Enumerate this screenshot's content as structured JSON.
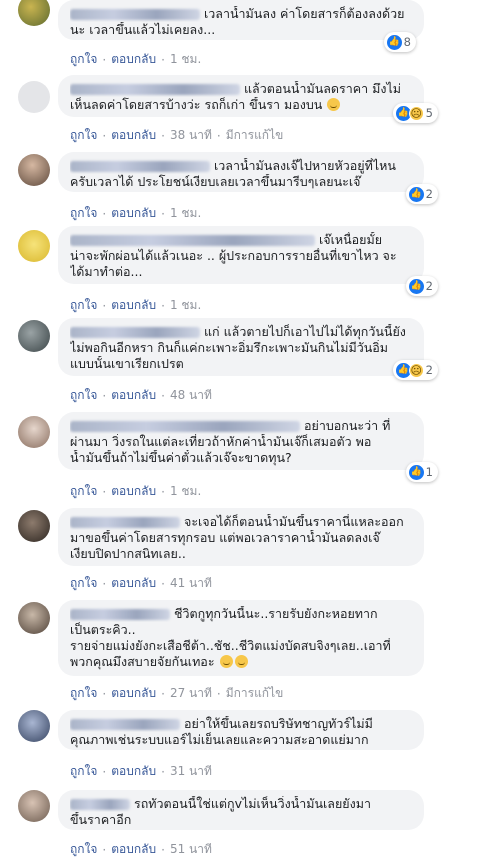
{
  "comments": [
    {
      "lines": [
        "เวลาน้ำมันลง ค่าโดยสารก็ต้องลงด้วย",
        "นะ เวลาขึ้นแล้วไม่เคยลง..."
      ],
      "like": "ถูกใจ",
      "reply": "ตอบกลับ",
      "time": "1 ชม.",
      "edited": "",
      "reactions": "8",
      "sad": false,
      "avatar_colors": [
        "#b9a24a",
        "#6f7a3a"
      ]
    },
    {
      "lines": [
        "แล้วตอนน้ำมันลดราคา มึงไม่",
        "เห็นลดค่าโดยสารบ้างว่ะ รถก็เก่า ขึ้นรา มองบน"
      ],
      "like": "ถูกใจ",
      "reply": "ตอบกลับ",
      "time": "38 นาที",
      "edited": "มีการแก้ไข",
      "reactions": "5",
      "sad": true,
      "avatar_colors": [
        "#e9e9ea",
        "#cfd0d3"
      ]
    },
    {
      "lines": [
        "เวลาน้ำมันลงเจ๊ไปหายหัวอยู่ที่ไหน",
        "ครับเวลาได้ ประโยชน์เงียบเลยเวลาขึ้นมารีบๆเลยนะเจ๊"
      ],
      "like": "ถูกใจ",
      "reply": "ตอบกลับ",
      "time": "1 ชม.",
      "edited": "",
      "reactions": "2",
      "sad": false,
      "avatar_colors": [
        "#c5a58f",
        "#6d5545"
      ]
    },
    {
      "lines": [
        "เจ๊เหนื่อยมั้ย",
        "น่าจะพักผ่อนได้แล้วเนอะ .. ผู้ประกอบการรายอื่นที่เขาไหว จะ",
        "ได้มาทำต่อ..."
      ],
      "like": "ถูกใจ",
      "reply": "ตอบกลับ",
      "time": "1 ชม.",
      "edited": "",
      "reactions": "2",
      "sad": false,
      "avatar_colors": [
        "#f3e06a",
        "#e8c93a"
      ]
    },
    {
      "lines": [
        "แก่ แล้วตายไปก็เอาไปไม่ได้ทุกวันนี้ยัง",
        "ไม่พอกินอีกหรา กินก็แค่กะเพาะอิ่มรึกะเพาะมันกินไม่มีวันอิ่ม",
        "แบบนั้นเขาเรียกเปรต"
      ],
      "like": "ถูกใจ",
      "reply": "ตอบกลับ",
      "time": "48 นาที",
      "edited": "",
      "reactions": "2",
      "sad": true,
      "avatar_colors": [
        "#7c8587",
        "#3f4a4c"
      ]
    },
    {
      "lines": [
        "อย่าบอกนะว่า ที่",
        "ผ่านมา วิ่งรถในแต่ละเที่ยวถ้าหักค่าน้ำมันเจ๊ก็เสมอตัว พอ",
        "น้ำมันขึ้นถ้าไม่ขึ้นค่าตั๋วแล้วเจ๊จะขาดทุน?"
      ],
      "like": "ถูกใจ",
      "reply": "ตอบกลับ",
      "time": "1 ชม.",
      "edited": "",
      "reactions": "1",
      "sad": false,
      "avatar_colors": [
        "#d9c7bc",
        "#8c7366"
      ]
    },
    {
      "lines": [
        "จะเจอได้ก็ตอนน้ำมันขึ้นราคานี่แหละออก",
        "มาขอขึ้นค่าโดยสารทุกรอบ แต่พอเวลาราคาน้ำมันลดลงเจ๊",
        "เงียบปิดปากสนิทเลย.."
      ],
      "like": "ถูกใจ",
      "reply": "ตอบกลับ",
      "time": "41 นาที",
      "edited": "",
      "reactions": "",
      "sad": false,
      "avatar_colors": [
        "#7b6a5d",
        "#2f2823"
      ]
    },
    {
      "lines": [
        "ชีวิตกูทุกวันนี้นะ..รายรับยังกะหอยทาก",
        "เป็นตระคิว..",
        "รายจ่ายแม่งยังกะเสือชีต้า..ชัช..ชีวิตแม่งบัดสบจิงๆเลย..เอาที่",
        "พวกคุณมึงสบายจัยกันเทอะ"
      ],
      "like": "ถูกใจ",
      "reply": "ตอบกลับ",
      "time": "27 นาที",
      "edited": "มีการแก้ไข",
      "reactions": "",
      "sad": false,
      "avatar_colors": [
        "#b7a898",
        "#4e4036"
      ]
    },
    {
      "lines": [
        "อย่าให้ขึ้นเลยรถบริษัทชาญทัวร์ไม่มี",
        "คุณภาพเช่นระบบแอร์ไม่เย็นเลยและความสะอาดแย่มาก"
      ],
      "like": "ถูกใจ",
      "reply": "ตอบกลับ",
      "time": "31 นาที",
      "edited": "",
      "reactions": "",
      "sad": false,
      "avatar_colors": [
        "#8fa0c2",
        "#3b4a6b"
      ]
    },
    {
      "lines": [
        "รถทัวตอนนี้ใช่แต่กูvไม่เห็นวิ่งน้ำมันเลยยังมา",
        "ขึ้นราคาอีก"
      ],
      "like": "ถูกใจ",
      "reply": "ตอบกลับ",
      "time": "51 นาที",
      "edited": "",
      "reactions": "",
      "sad": false,
      "avatar_colors": [
        "#c9b1a0",
        "#6b5a4e"
      ]
    }
  ],
  "colors": {
    "link": "#385898",
    "muted": "#90949c",
    "bubble": "#f2f3f5",
    "like_blue": "#1877f2"
  }
}
